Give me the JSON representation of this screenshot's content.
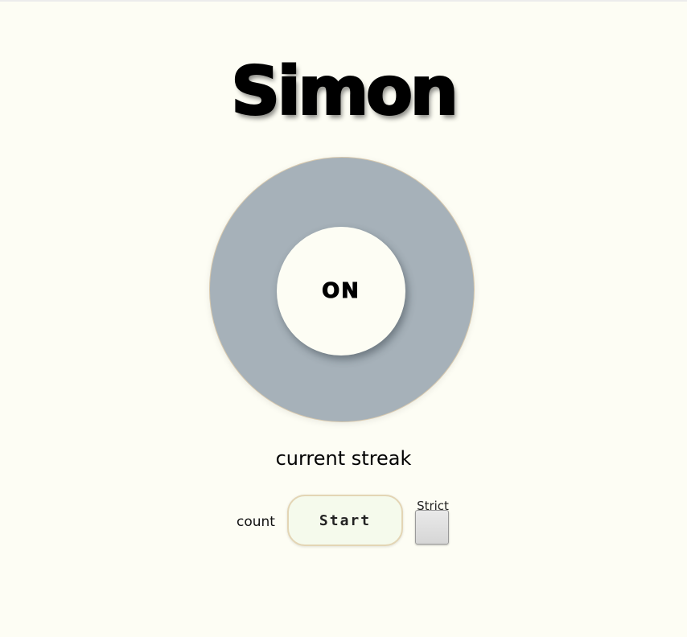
{
  "title": "Simon",
  "board": {
    "center_label": "ON",
    "color": "#a6b1b9"
  },
  "streak_label": "current streak",
  "controls": {
    "count_label": "count",
    "start_label": "Start",
    "strict_label": "Strict"
  }
}
